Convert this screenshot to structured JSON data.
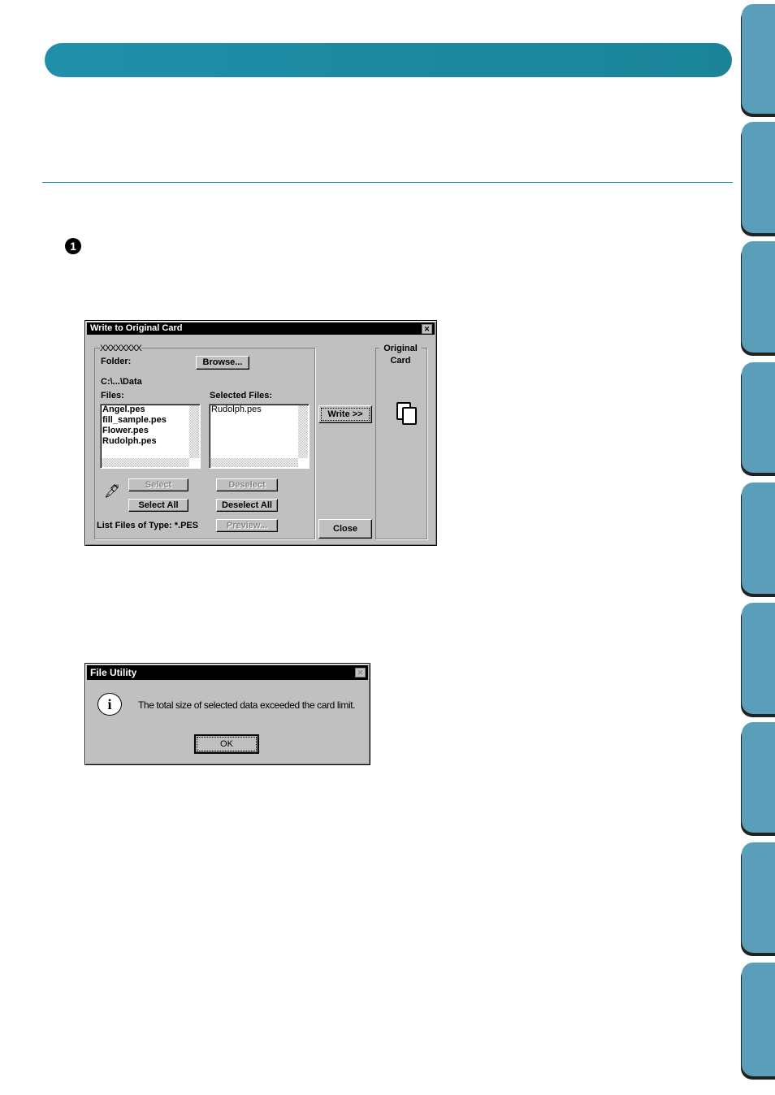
{
  "dialog1": {
    "title": "Write to Original Card",
    "group_label": "XXXXXXXX",
    "folder_label": "Folder:",
    "browse": "Browse...",
    "path": "C:\\...\\Data",
    "files_label": "Files:",
    "selected_label": "Selected Files:",
    "files": [
      "Angel.pes",
      "fill_sample.pes",
      "Flower.pes",
      "Rudolph.pes"
    ],
    "selected_files": [
      "Rudolph.pes"
    ],
    "write": "Write >>",
    "card_label": "Original Card",
    "select": "Select",
    "select_all": "Select All",
    "deselect": "Deselect",
    "deselect_all": "Deselect All",
    "list_type": "List Files of Type: *.PES",
    "preview": "Preview...",
    "close": "Close"
  },
  "dialog2": {
    "title": "File Utility",
    "message": "The total size of selected data exceeded the card limit.",
    "ok": "OK"
  },
  "step_number": "1",
  "colors": {
    "banner": "#1c8aa3",
    "tabs": "#5b9eb9"
  }
}
